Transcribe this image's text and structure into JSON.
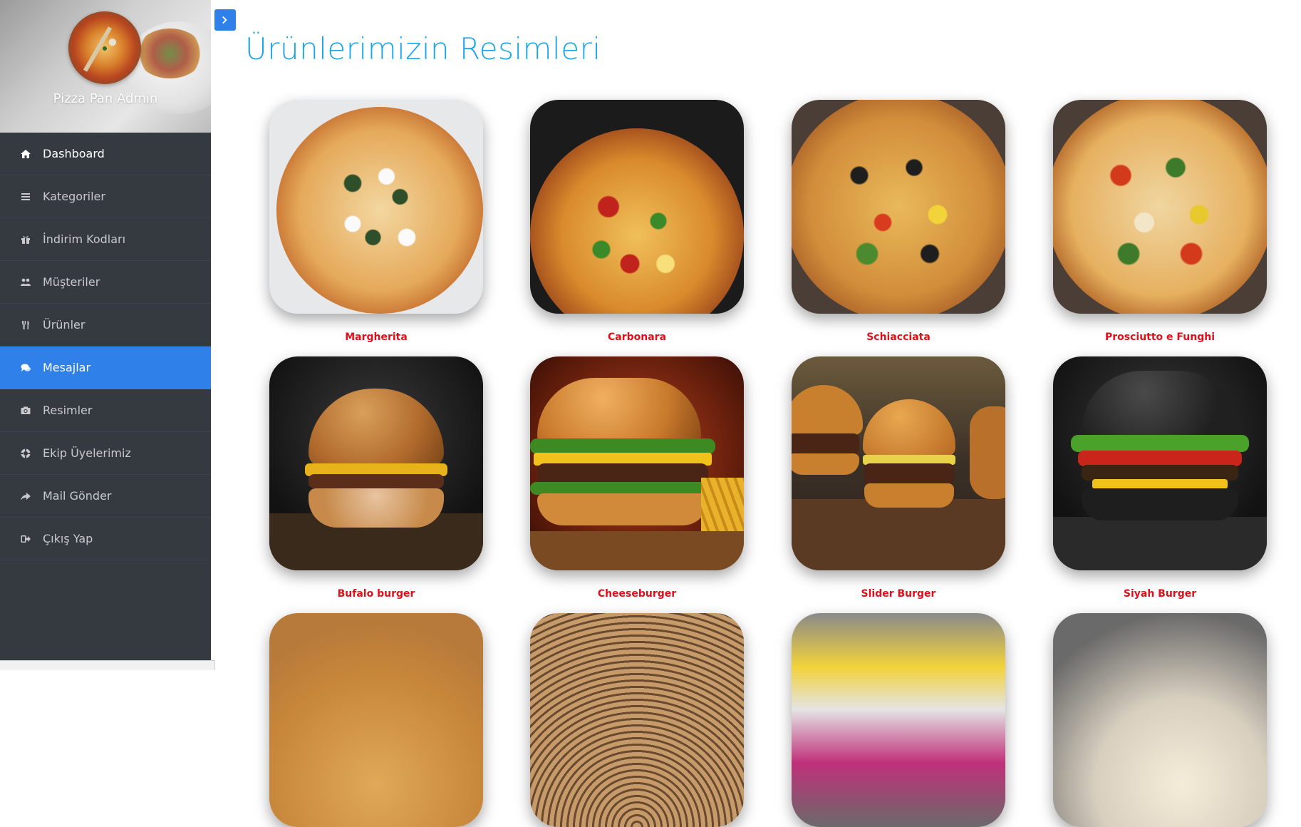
{
  "sidebar": {
    "brand": "Pizza Pan Admin",
    "items": [
      {
        "label": "Dashboard",
        "icon": "home-icon"
      },
      {
        "label": "Kategoriler",
        "icon": "list-icon"
      },
      {
        "label": "İndirim Kodları",
        "icon": "gift-icon"
      },
      {
        "label": "Müşteriler",
        "icon": "users-icon"
      },
      {
        "label": "Ürünler",
        "icon": "cutlery-icon"
      },
      {
        "label": "Mesajlar",
        "icon": "comments-icon"
      },
      {
        "label": "Resimler",
        "icon": "camera-icon"
      },
      {
        "label": "Ekip Üyelerimiz",
        "icon": "life-ring-icon"
      },
      {
        "label": "Mail Gönder",
        "icon": "share-icon"
      },
      {
        "label": "Çıkış Yap",
        "icon": "sign-out-icon"
      }
    ],
    "active_item": "Mesajlar"
  },
  "main": {
    "title": "Ürünlerimizin Resimleri",
    "products": [
      {
        "name": "Margherita"
      },
      {
        "name": "Carbonara"
      },
      {
        "name": "Schiacciata"
      },
      {
        "name": "Prosciutto e Funghi"
      },
      {
        "name": "Bufalo burger"
      },
      {
        "name": "Cheeseburger"
      },
      {
        "name": "Slider Burger"
      },
      {
        "name": "Siyah Burger"
      }
    ]
  },
  "colors": {
    "sidebar_bg": "#343a40",
    "active_bg": "#2f80e8",
    "title_color": "#1aa6e8",
    "product_name_color": "#e0101a"
  }
}
